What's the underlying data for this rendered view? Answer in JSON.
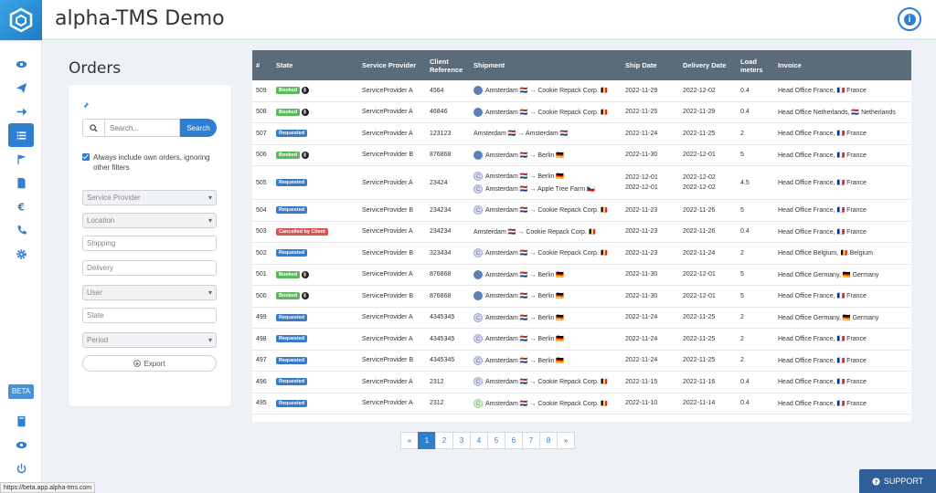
{
  "app": {
    "title": "alpha-TMS Demo",
    "status_url": "https://beta.app.alpha-tms.com"
  },
  "sidebar": {
    "items": [
      {
        "icon": "eye-icon",
        "active": false
      },
      {
        "icon": "paper-plane-icon",
        "active": false
      },
      {
        "icon": "arrow-right-icon",
        "active": false
      },
      {
        "icon": "list-icon",
        "active": true
      },
      {
        "icon": "flag-icon",
        "active": false
      },
      {
        "icon": "document-icon",
        "active": false
      },
      {
        "icon": "euro-icon",
        "active": false
      },
      {
        "icon": "phone-icon",
        "active": false
      },
      {
        "icon": "gear-icon",
        "active": false
      }
    ],
    "beta_label": "BETA",
    "bottom_items": [
      {
        "icon": "book-icon"
      },
      {
        "icon": "eye-icon"
      },
      {
        "icon": "power-icon"
      }
    ]
  },
  "page": {
    "title": "Orders"
  },
  "filters": {
    "search_placeholder": "Search...",
    "search_button": "Search",
    "own_orders_label": "Always include own orders, ignoring other filters",
    "own_orders_checked": true,
    "fields": [
      {
        "label": "Service Provider",
        "type": "select"
      },
      {
        "label": "Location",
        "type": "select"
      },
      {
        "label": "Shipping",
        "type": "text"
      },
      {
        "label": "Delivery",
        "type": "text"
      },
      {
        "label": "User",
        "type": "select"
      },
      {
        "label": "State",
        "type": "text"
      },
      {
        "label": "Period",
        "type": "select"
      }
    ],
    "export_label": "Export"
  },
  "table": {
    "columns": [
      "#",
      "State",
      "Service Provider",
      "Client Reference",
      "Shipment",
      "Ship Date",
      "Delivery Date",
      "Load meters",
      "Invoice"
    ],
    "rows": [
      {
        "id": "509",
        "state": "Booked",
        "globe": true,
        "provider": "ServiceProvider A",
        "ref": "4564",
        "shipments": [
          {
            "avatar": "photo",
            "text": "Amsterdam 🇳🇱 → Cookie Repack Corp. 🇧🇪"
          }
        ],
        "ship": [
          "2022-11-29"
        ],
        "delivery": [
          "2022-12-02"
        ],
        "load": "0.4",
        "invoice": "Head Office France, 🇫🇷 France"
      },
      {
        "id": "508",
        "state": "Booked",
        "globe": true,
        "provider": "ServiceProvider A",
        "ref": "46846",
        "shipments": [
          {
            "avatar": "photo",
            "text": "Amsterdam 🇳🇱 → Cookie Repack Corp. 🇧🇪"
          }
        ],
        "ship": [
          "2022-11-25"
        ],
        "delivery": [
          "2022-11-29"
        ],
        "load": "0.4",
        "invoice": "Head Office Netherlands, 🇳🇱 Netherlands"
      },
      {
        "id": "507",
        "state": "Requested",
        "globe": false,
        "provider": "ServiceProvider A",
        "ref": "123123",
        "shipments": [
          {
            "avatar": "none",
            "text": "Amsterdam 🇳🇱 → Amsterdam 🇳🇱"
          }
        ],
        "ship": [
          "2022-11-24"
        ],
        "delivery": [
          "2022-11-25"
        ],
        "load": "2",
        "invoice": "Head Office France, 🇫🇷 France"
      },
      {
        "id": "506",
        "state": "Booked",
        "globe": true,
        "provider": "ServiceProvider B",
        "ref": "876868",
        "shipments": [
          {
            "avatar": "photo",
            "text": "Amsterdam 🇳🇱 → Berlin 🇩🇪"
          }
        ],
        "ship": [
          "2022-11-30"
        ],
        "delivery": [
          "2022-12-01"
        ],
        "load": "5",
        "invoice": "Head Office France, 🇫🇷 France"
      },
      {
        "id": "505",
        "state": "Requested",
        "globe": false,
        "provider": "ServiceProvider A",
        "ref": "23424",
        "shipments": [
          {
            "avatar": "letter",
            "text": "Amsterdam 🇳🇱 → Berlin 🇩🇪"
          },
          {
            "avatar": "letter",
            "text": "Amsterdam 🇳🇱 → Apple Tree Farm 🇨🇿"
          }
        ],
        "ship": [
          "2022-12-01",
          "2022-12-01"
        ],
        "delivery": [
          "2022-12-02",
          "2022-12-02"
        ],
        "load": "4.5",
        "invoice": "Head Office France, 🇫🇷 France"
      },
      {
        "id": "504",
        "state": "Requested",
        "globe": false,
        "provider": "ServiceProvider B",
        "ref": "234234",
        "shipments": [
          {
            "avatar": "letter",
            "text": "Amsterdam 🇳🇱 → Cookie Repack Corp. 🇧🇪"
          }
        ],
        "ship": [
          "2022-11-23"
        ],
        "delivery": [
          "2022-11-26"
        ],
        "load": "5",
        "invoice": "Head Office France, 🇫🇷 France"
      },
      {
        "id": "503",
        "state": "Cancelled by Client",
        "globe": false,
        "provider": "ServiceProvider A",
        "ref": "234234",
        "shipments": [
          {
            "avatar": "none",
            "text": "Amsterdam 🇳🇱 → Cookie Repack Corp. 🇧🇪"
          }
        ],
        "ship": [
          "2022-11-23"
        ],
        "delivery": [
          "2022-11-26"
        ],
        "load": "0.4",
        "invoice": "Head Office France, 🇫🇷 France"
      },
      {
        "id": "502",
        "state": "Requested",
        "globe": false,
        "provider": "ServiceProvider B",
        "ref": "323434",
        "shipments": [
          {
            "avatar": "letter",
            "text": "Amsterdam 🇳🇱 → Cookie Repack Corp. 🇧🇪"
          }
        ],
        "ship": [
          "2022-11-23"
        ],
        "delivery": [
          "2022-11-24"
        ],
        "load": "2",
        "invoice": "Head Office Belgium, 🇧🇪 Belgium"
      },
      {
        "id": "501",
        "state": "Booked",
        "globe": true,
        "provider": "ServiceProvider A",
        "ref": "876868",
        "shipments": [
          {
            "avatar": "photo",
            "text": "Amsterdam 🇳🇱 → Berlin 🇩🇪"
          }
        ],
        "ship": [
          "2022-11-30"
        ],
        "delivery": [
          "2022-12-01"
        ],
        "load": "5",
        "invoice": "Head Office Germany, 🇩🇪 Germany"
      },
      {
        "id": "500",
        "state": "Booked",
        "globe": true,
        "provider": "ServiceProvider B",
        "ref": "876868",
        "shipments": [
          {
            "avatar": "photo",
            "text": "Amsterdam 🇳🇱 → Berlin 🇩🇪"
          }
        ],
        "ship": [
          "2022-11-30"
        ],
        "delivery": [
          "2022-12-01"
        ],
        "load": "5",
        "invoice": "Head Office France, 🇫🇷 France"
      },
      {
        "id": "499",
        "state": "Requested",
        "globe": false,
        "provider": "ServiceProvider A",
        "ref": "4345345",
        "shipments": [
          {
            "avatar": "letter",
            "text": "Amsterdam 🇳🇱 → Berlin 🇩🇪"
          }
        ],
        "ship": [
          "2022-11-24"
        ],
        "delivery": [
          "2022-11-25"
        ],
        "load": "2",
        "invoice": "Head Office Germany, 🇩🇪 Germany"
      },
      {
        "id": "498",
        "state": "Requested",
        "globe": false,
        "provider": "ServiceProvider A",
        "ref": "4345345",
        "shipments": [
          {
            "avatar": "letter",
            "text": "Amsterdam 🇳🇱 → Berlin 🇩🇪"
          }
        ],
        "ship": [
          "2022-11-24"
        ],
        "delivery": [
          "2022-11-25"
        ],
        "load": "2",
        "invoice": "Head Office France, 🇫🇷 France"
      },
      {
        "id": "497",
        "state": "Requested",
        "globe": false,
        "provider": "ServiceProvider B",
        "ref": "4345345",
        "shipments": [
          {
            "avatar": "letter",
            "text": "Amsterdam 🇳🇱 → Berlin 🇩🇪"
          }
        ],
        "ship": [
          "2022-11-24"
        ],
        "delivery": [
          "2022-11-25"
        ],
        "load": "2",
        "invoice": "Head Office France, 🇫🇷 France"
      },
      {
        "id": "496",
        "state": "Requested",
        "globe": false,
        "provider": "ServiceProvider A",
        "ref": "2312",
        "shipments": [
          {
            "avatar": "letter",
            "text": "Amsterdam 🇳🇱 → Cookie Repack Corp. 🇧🇪"
          }
        ],
        "ship": [
          "2022-11-15"
        ],
        "delivery": [
          "2022-11-16"
        ],
        "load": "0.4",
        "invoice": "Head Office France, 🇫🇷 France"
      },
      {
        "id": "495",
        "state": "Requested",
        "globe": false,
        "provider": "ServiceProvider A",
        "ref": "2312",
        "shipments": [
          {
            "avatar": "letter-green",
            "text": "Amsterdam 🇳🇱 → Cookie Repack Corp. 🇧🇪"
          }
        ],
        "ship": [
          "2022-11-10"
        ],
        "delivery": [
          "2022-11-14"
        ],
        "load": "0.4",
        "invoice": "Head Office France, 🇫🇷 France"
      }
    ]
  },
  "pagination": {
    "prev": "«",
    "pages": [
      "1",
      "2",
      "3",
      "4",
      "5",
      "6",
      "7",
      "8"
    ],
    "next": "»",
    "current": "1"
  },
  "support": {
    "label": "SUPPORT"
  },
  "colors": {
    "accent": "#2f7fd0",
    "booked": "#5cb85c",
    "requested": "#3a7bc8",
    "cancelled": "#d9534f",
    "header": "#5a6b7a"
  }
}
